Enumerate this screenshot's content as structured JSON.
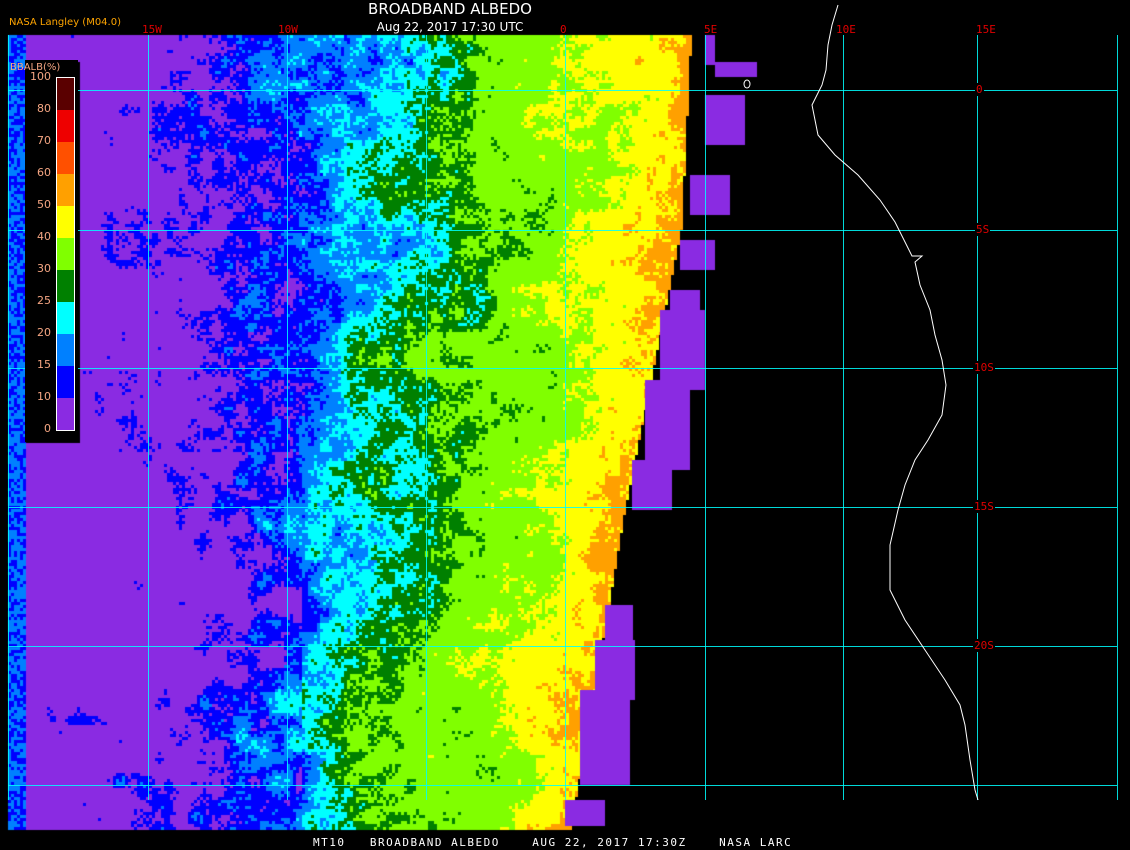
{
  "header": {
    "title": "BROADBAND ALBEDO",
    "subtitle": "Aug 22, 2017 17:30 UTC",
    "credit": "NASA Langley (M04.0)"
  },
  "footer": "MT10   BROADBAND ALBEDO    AUG 22, 2017 17:30Z    NASA LARC",
  "longitude_labels": [
    "15W",
    "10W",
    "0",
    "5E",
    "10E",
    "15E"
  ],
  "latitude_labels": [
    "0",
    "5S",
    "10S",
    "15S",
    "20S"
  ],
  "legend": {
    "title": "BBALB(%)",
    "labels": [
      "100",
      "80",
      "70",
      "60",
      "50",
      "40",
      "30",
      "25",
      "20",
      "15",
      "10",
      "0"
    ],
    "bins": [
      {
        "min": 0,
        "max": 10,
        "color": "#8a2be2"
      },
      {
        "min": 10,
        "max": 15,
        "color": "#0000ff"
      },
      {
        "min": 15,
        "max": 20,
        "color": "#0080ff"
      },
      {
        "min": 20,
        "max": 25,
        "color": "#00ffff"
      },
      {
        "min": 25,
        "max": 30,
        "color": "#008000"
      },
      {
        "min": 30,
        "max": 40,
        "color": "#80ff00"
      },
      {
        "min": 40,
        "max": 50,
        "color": "#ffff00"
      },
      {
        "min": 50,
        "max": 60,
        "color": "#ffa000"
      },
      {
        "min": 60,
        "max": 70,
        "color": "#ff5000"
      },
      {
        "min": 70,
        "max": 80,
        "color": "#ee0000"
      },
      {
        "min": 80,
        "max": 100,
        "color": "#5a0000"
      }
    ]
  },
  "colors": {
    "grid": "#00ffff",
    "coast": "#ffffff",
    "label": "#e00000",
    "no_data": "#8a2be2"
  }
}
